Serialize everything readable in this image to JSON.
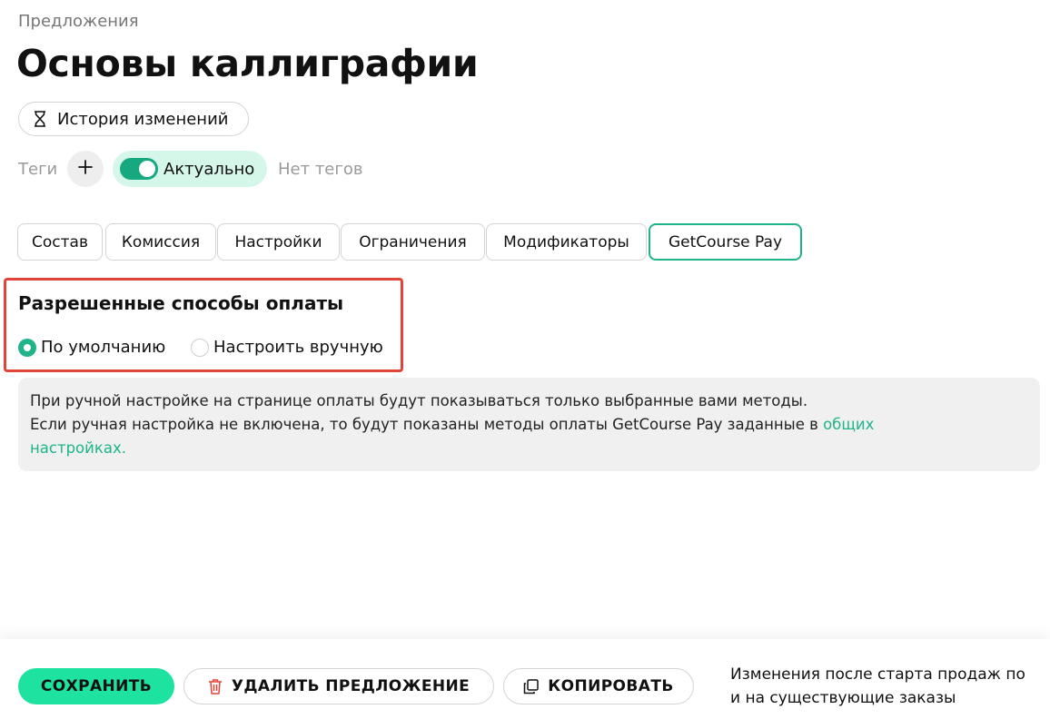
{
  "breadcrumb": "Предложения",
  "title": "Основы каллиграфии",
  "history_button": {
    "label": "История изменений",
    "icon": "hourglass-icon"
  },
  "tags": {
    "label": "Теги",
    "add_icon": "plus-icon",
    "status_label": "Актуально",
    "status_enabled": true,
    "empty_text": "Нет тегов"
  },
  "tabs": [
    {
      "label": "Состав",
      "active": false
    },
    {
      "label": "Комиссия",
      "active": false
    },
    {
      "label": "Настройки",
      "active": false
    },
    {
      "label": "Ограничения",
      "active": false
    },
    {
      "label": "Модификаторы",
      "active": false
    },
    {
      "label": "GetCourse Pay",
      "active": true
    }
  ],
  "payment_methods": {
    "title": "Разрешенные способы оплаты",
    "options": [
      {
        "label": "По умолчанию",
        "selected": true
      },
      {
        "label": "Настроить вручную",
        "selected": false
      }
    ]
  },
  "info": {
    "line1": "При ручной настройке на странице оплаты будут показываться только выбранные вами методы.",
    "line2": "Если ручная настройка не включена, то будут показаны методы оплаты GetCourse Pay заданные в ",
    "link_word1": "общих",
    "link_word2": "настройках."
  },
  "footer": {
    "save_label": "СОХРАНИТЬ",
    "delete_label": "УДАЛИТЬ ПРЕДЛОЖЕНИЕ",
    "copy_label": "КОПИРОВАТЬ",
    "notice_line1": "Изменения после старта продаж по",
    "notice_line2": "и на существующие заказы"
  },
  "colors": {
    "accent": "#1fb48a",
    "save_button": "#1ee3a0",
    "status_bg": "#d5f7ea",
    "highlight": "#e0453a",
    "delete_icon": "#e0453a"
  }
}
